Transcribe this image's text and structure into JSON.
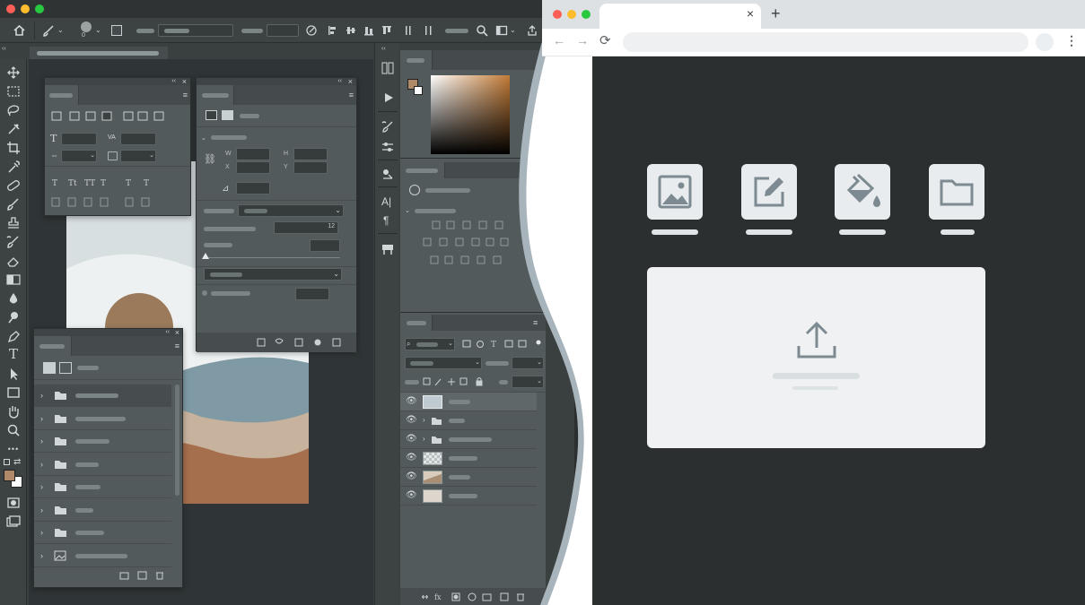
{
  "photoshop": {
    "window_dots": [
      "#fc5f57",
      "#fdbc2e",
      "#28c840"
    ],
    "options_bar": {
      "home_icon": "home-icon",
      "brush_icon": "brush-icon",
      "brush_size": "0"
    },
    "tools": [
      "move-icon",
      "marquee-icon",
      "lasso-icon",
      "quick-select-icon",
      "crop-icon",
      "eyedropper-icon",
      "healing-icon",
      "brush-icon",
      "stamp-icon",
      "history-brush-icon",
      "eraser-icon",
      "gradient-icon",
      "blur-icon",
      "dodge-icon",
      "pen-icon",
      "type-icon",
      "path-select-icon",
      "shape-icon",
      "hand-icon",
      "zoom-icon",
      "more-icon"
    ],
    "type_tool_glyph": "T",
    "more_glyph": "•••",
    "character_panel": {
      "type_glyph": "T",
      "tracking_glyph": "VA"
    },
    "properties_panel": {
      "number_value": "12"
    },
    "artwork_colors": {
      "sky": "#d7dfe1",
      "sun": "#9a7a5b",
      "hills_blue": "#7f9aa4",
      "hills_beige": "#c7b29d",
      "hills_brown": "#a56e4c"
    },
    "swatches": {
      "foreground": "#b08a68",
      "background": "#ffffff"
    },
    "layers": {
      "rows": [
        {
          "thumb": "artwork",
          "folder": false
        },
        {
          "thumb": "none",
          "folder": true
        },
        {
          "thumb": "none",
          "folder": true
        },
        {
          "thumb": "transparent",
          "folder": false
        },
        {
          "thumb": "beige",
          "folder": false
        },
        {
          "thumb": "light",
          "folder": false
        }
      ]
    },
    "library_panel": {
      "rows": [
        "folder",
        "folder",
        "folder",
        "folder",
        "folder",
        "folder",
        "folder",
        "image",
        "folder"
      ]
    }
  },
  "browser": {
    "window_dots": [
      "#fc5f57",
      "#fdbc2e",
      "#28c840"
    ],
    "tab_close": "×",
    "new_tab": "+",
    "nav": {
      "back": "←",
      "forward": "→",
      "reload": "⟳",
      "menu": "⋮"
    },
    "cards": [
      {
        "icon": "image-icon"
      },
      {
        "icon": "edit-icon"
      },
      {
        "icon": "paint-bucket-icon"
      },
      {
        "icon": "folder-icon"
      }
    ],
    "upload_icon": "upload-icon",
    "divider_color": "#a8b4bb"
  }
}
